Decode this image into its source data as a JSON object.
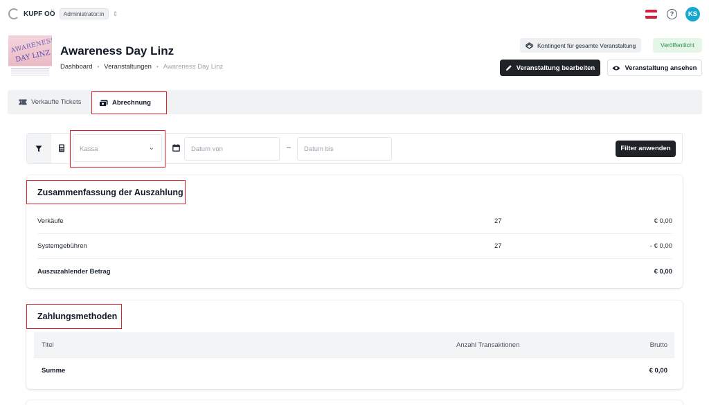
{
  "topbar": {
    "org_name": "KUPF OÖ",
    "role": "Administrator:in",
    "avatar_initials": "KS",
    "avatar_color": "#16a8cf",
    "help_icon": "question-circle-icon",
    "flag_icon": "austria-flag-icon"
  },
  "event": {
    "thumbnail_text_1": "AWARENESS",
    "thumbnail_text_2": "DAY LINZ",
    "title": "Awareness Day Linz",
    "breadcrumb": [
      "Dashboard",
      "Veranstaltungen",
      "Awareness Day Linz"
    ],
    "kontingent_label": "Kontingent für gesamte Veranstaltung",
    "status": "Veröffentlicht",
    "status_color": "#2f8c49",
    "edit_label": "Veranstaltung bearbeiten",
    "view_label": "Veranstaltung ansehen"
  },
  "tabs": [
    {
      "label": "Verkaufte Tickets",
      "icon": "ticket-icon",
      "active": false
    },
    {
      "label": "Abrechnung",
      "icon": "money-icon",
      "active": true
    }
  ],
  "filter": {
    "kassa_placeholder": "Kassa",
    "date_from_placeholder": "Datum von",
    "date_to_placeholder": "Datum bis",
    "separator": "–",
    "apply_label": "Filter anwenden"
  },
  "summary": {
    "title": "Zusammenfassung der Auszahlung",
    "rows": [
      {
        "label": "Verkäufe",
        "count": "27",
        "amount": "€ 0,00"
      },
      {
        "label": "Systemgebühren",
        "count": "27",
        "amount": "- € 0,00"
      },
      {
        "label": "Auszuzahlender Betrag",
        "count": "",
        "amount": "€ 0,00"
      }
    ]
  },
  "payments": {
    "title": "Zahlungsmethoden",
    "columns": [
      "Titel",
      "Anzahl Transaktionen",
      "Brutto"
    ],
    "total_label": "Summe",
    "total_amount": "€ 0,00"
  },
  "accent_color": "#d9262b"
}
